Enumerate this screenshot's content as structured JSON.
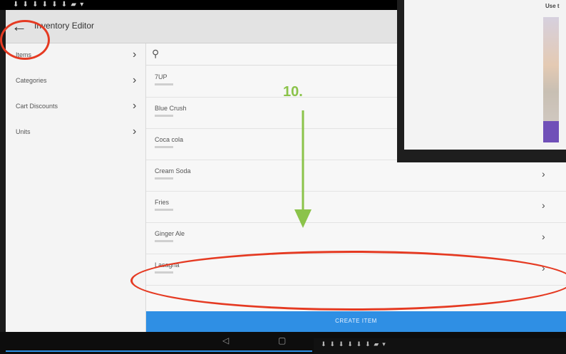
{
  "app": {
    "title": "Inventory Editor"
  },
  "sidebar": {
    "items": [
      {
        "label": "Items"
      },
      {
        "label": "Categories"
      },
      {
        "label": "Cart Discounts"
      },
      {
        "label": "Units"
      }
    ]
  },
  "search": {
    "placeholder": ""
  },
  "items": [
    {
      "name": "7UP"
    },
    {
      "name": "Blue Crush"
    },
    {
      "name": "Coca cola"
    },
    {
      "name": "Cream Soda"
    },
    {
      "name": "Fries"
    },
    {
      "name": "Ginger Ale"
    },
    {
      "name": "Lasagna"
    }
  ],
  "create_button": {
    "label": "CREATE ITEM"
  },
  "annotation": {
    "step": "10."
  },
  "overlay": {
    "snippet": "Use t"
  },
  "colors": {
    "accent": "#2f8fe4",
    "highlight": "#e53a22",
    "arrow": "#8bc34a"
  },
  "icons": [
    "back-arrow-icon",
    "search-icon",
    "chevron-right-icon",
    "nav-back-icon",
    "nav-home-icon"
  ]
}
